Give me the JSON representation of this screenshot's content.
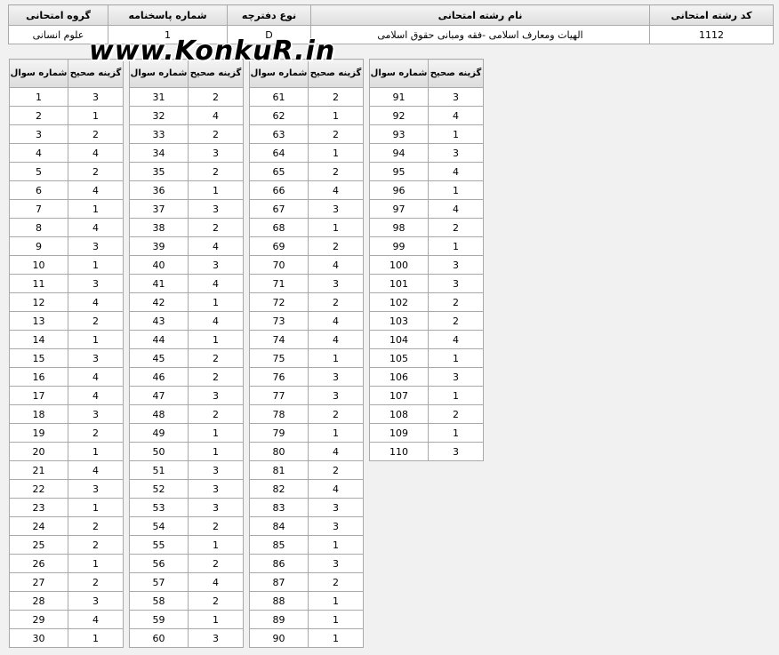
{
  "info": {
    "headers": {
      "code": "کد رشته امتحانی",
      "name": "نام رشته امتحانی",
      "booklet": "نوع دفترچه",
      "answer_sheet": "شماره پاسخنامه",
      "group": "گروه امتحانی"
    },
    "values": {
      "code": "1112",
      "name": "الهیات ومعارف اسلامی -فقه ومبانی حقوق اسلامی",
      "booklet": "D",
      "answer_sheet": "1",
      "group": "علوم انسانی"
    }
  },
  "watermark": "www.KonkuR.in",
  "answer_headers": {
    "question": "شماره سوال",
    "answer": "گزینه صحیح"
  },
  "answer_groups": [
    [
      [
        1,
        3
      ],
      [
        2,
        1
      ],
      [
        3,
        2
      ],
      [
        4,
        4
      ],
      [
        5,
        2
      ],
      [
        6,
        4
      ],
      [
        7,
        1
      ],
      [
        8,
        4
      ],
      [
        9,
        3
      ],
      [
        10,
        1
      ],
      [
        11,
        3
      ],
      [
        12,
        4
      ],
      [
        13,
        2
      ],
      [
        14,
        1
      ],
      [
        15,
        3
      ],
      [
        16,
        4
      ],
      [
        17,
        4
      ],
      [
        18,
        3
      ],
      [
        19,
        2
      ],
      [
        20,
        1
      ],
      [
        21,
        4
      ],
      [
        22,
        3
      ],
      [
        23,
        1
      ],
      [
        24,
        2
      ],
      [
        25,
        2
      ],
      [
        26,
        1
      ],
      [
        27,
        2
      ],
      [
        28,
        3
      ],
      [
        29,
        4
      ],
      [
        30,
        1
      ]
    ],
    [
      [
        31,
        2
      ],
      [
        32,
        4
      ],
      [
        33,
        2
      ],
      [
        34,
        3
      ],
      [
        35,
        2
      ],
      [
        36,
        1
      ],
      [
        37,
        3
      ],
      [
        38,
        2
      ],
      [
        39,
        4
      ],
      [
        40,
        3
      ],
      [
        41,
        4
      ],
      [
        42,
        1
      ],
      [
        43,
        4
      ],
      [
        44,
        1
      ],
      [
        45,
        2
      ],
      [
        46,
        2
      ],
      [
        47,
        3
      ],
      [
        48,
        2
      ],
      [
        49,
        1
      ],
      [
        50,
        1
      ],
      [
        51,
        3
      ],
      [
        52,
        3
      ],
      [
        53,
        3
      ],
      [
        54,
        2
      ],
      [
        55,
        1
      ],
      [
        56,
        2
      ],
      [
        57,
        4
      ],
      [
        58,
        2
      ],
      [
        59,
        1
      ],
      [
        60,
        3
      ]
    ],
    [
      [
        61,
        2
      ],
      [
        62,
        1
      ],
      [
        63,
        2
      ],
      [
        64,
        1
      ],
      [
        65,
        2
      ],
      [
        66,
        4
      ],
      [
        67,
        3
      ],
      [
        68,
        1
      ],
      [
        69,
        2
      ],
      [
        70,
        4
      ],
      [
        71,
        3
      ],
      [
        72,
        2
      ],
      [
        73,
        4
      ],
      [
        74,
        4
      ],
      [
        75,
        1
      ],
      [
        76,
        3
      ],
      [
        77,
        3
      ],
      [
        78,
        2
      ],
      [
        79,
        1
      ],
      [
        80,
        4
      ],
      [
        81,
        2
      ],
      [
        82,
        4
      ],
      [
        83,
        3
      ],
      [
        84,
        3
      ],
      [
        85,
        1
      ],
      [
        86,
        3
      ],
      [
        87,
        2
      ],
      [
        88,
        1
      ],
      [
        89,
        1
      ],
      [
        90,
        1
      ]
    ],
    [
      [
        91,
        3
      ],
      [
        92,
        4
      ],
      [
        93,
        1
      ],
      [
        94,
        3
      ],
      [
        95,
        4
      ],
      [
        96,
        1
      ],
      [
        97,
        4
      ],
      [
        98,
        2
      ],
      [
        99,
        1
      ],
      [
        100,
        3
      ],
      [
        101,
        3
      ],
      [
        102,
        2
      ],
      [
        103,
        2
      ],
      [
        104,
        4
      ],
      [
        105,
        1
      ],
      [
        106,
        3
      ],
      [
        107,
        1
      ],
      [
        108,
        2
      ],
      [
        109,
        1
      ],
      [
        110,
        3
      ]
    ]
  ]
}
